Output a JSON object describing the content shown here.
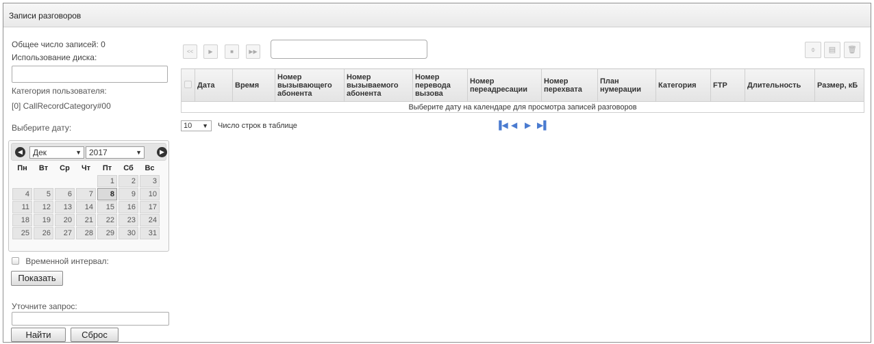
{
  "title": "Записи разговоров",
  "info": {
    "total_records": "Общее число записей: 0",
    "disk_usage_label": "Использование диска:",
    "user_category_label": "Категория пользователя:",
    "user_category_value": "[0] CallRecordCategory#00",
    "select_date_label": "Выберите дату:"
  },
  "calendar": {
    "month": "Дек",
    "year": "2017",
    "weekdays": [
      "Пн",
      "Вт",
      "Ср",
      "Чт",
      "Пт",
      "Сб",
      "Вс"
    ],
    "weeks": [
      [
        "",
        "",
        "",
        "",
        "1",
        "2",
        "3"
      ],
      [
        "4",
        "5",
        "6",
        "7",
        "8",
        "9",
        "10"
      ],
      [
        "11",
        "12",
        "13",
        "14",
        "15",
        "16",
        "17"
      ],
      [
        "18",
        "19",
        "20",
        "21",
        "22",
        "23",
        "24"
      ],
      [
        "25",
        "26",
        "27",
        "28",
        "29",
        "30",
        "31"
      ]
    ],
    "today": "8"
  },
  "time_interval_label": "Временной интервал:",
  "show_button": "Показать",
  "refine_label": "Уточните запрос:",
  "find_button": "Найти",
  "reset_button": "Сброс",
  "player": {
    "buttons": [
      "rewind-icon",
      "play-icon",
      "stop-icon",
      "fast-forward-icon"
    ],
    "glyphs": [
      "<<",
      "▶",
      "■",
      "▶▶"
    ]
  },
  "toolbar_right": {
    "icons": [
      "refresh-icon",
      "save-icon",
      "delete-icon"
    ],
    "glyphs": [
      "⌽",
      "▤",
      "🗑"
    ]
  },
  "table": {
    "headers": [
      "Дата",
      "Время",
      "Номер вызывающего абонента",
      "Номер вызываемого абонента",
      "Номер перевода вызова",
      "Номер переадресации",
      "Номер перехвата",
      "План нумерации",
      "Категория",
      "FTP",
      "Длительность",
      "Размер, кБ"
    ],
    "empty_message": "Выберите дату на календаре для просмотра записей разговоров"
  },
  "pagination": {
    "rows_per_page": "10",
    "rows_label": "Число строк в таблице"
  },
  "colors": {
    "pager_arrows": "#4a7bd0"
  }
}
